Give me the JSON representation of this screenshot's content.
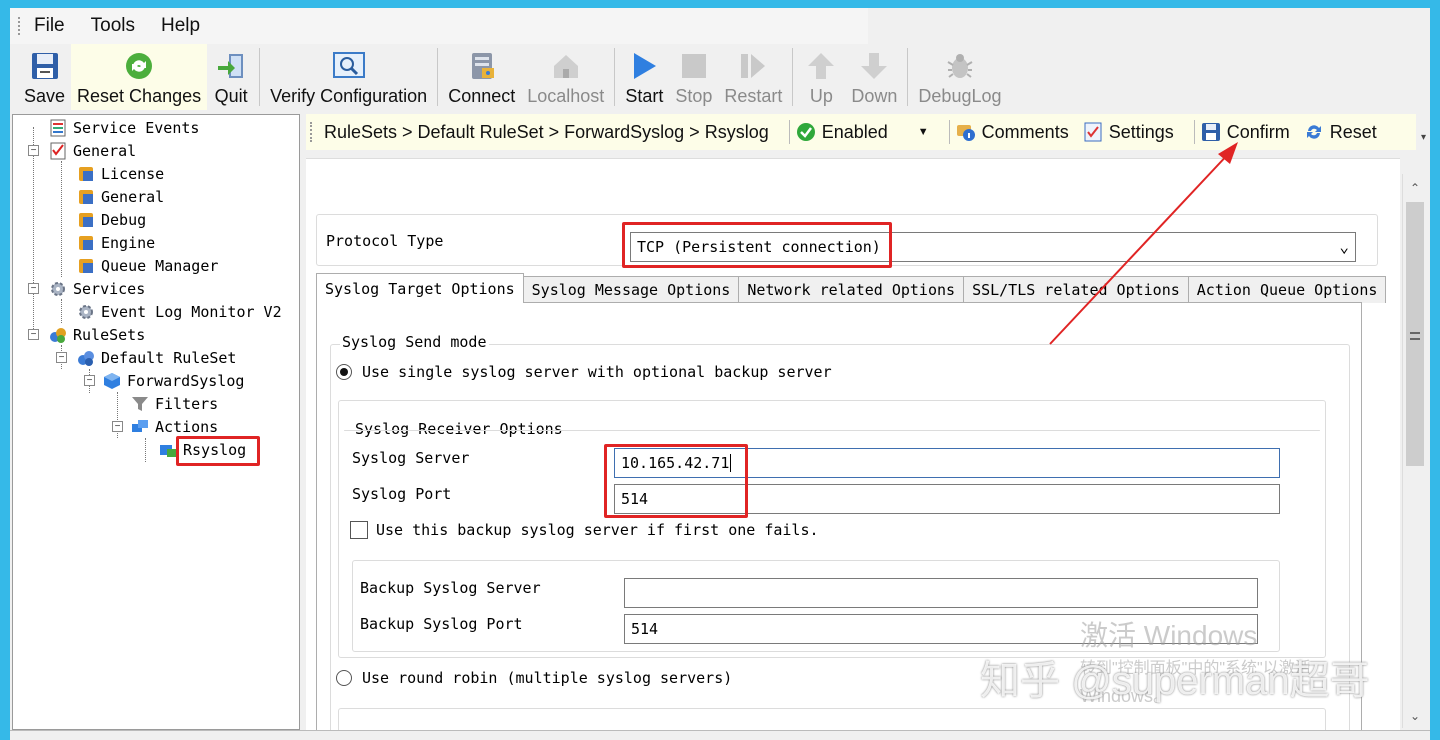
{
  "menu": [
    "File",
    "Tools",
    "Help"
  ],
  "toolbar": {
    "save": "Save",
    "reset_changes": "Reset Changes",
    "quit": "Quit",
    "verify": "Verify Configuration",
    "connect": "Connect",
    "localhost": "Localhost",
    "start": "Start",
    "stop": "Stop",
    "restart": "Restart",
    "up": "Up",
    "down": "Down",
    "debuglog": "DebugLog"
  },
  "tree": {
    "service_events": "Service Events",
    "general": "General",
    "license": "License",
    "general_child": "General",
    "debug": "Debug",
    "engine": "Engine",
    "queue_manager": "Queue Manager",
    "services": "Services",
    "event_log_monitor": "Event Log Monitor V2",
    "rulesets": "RuleSets",
    "default_ruleset": "Default RuleSet",
    "forward_syslog": "ForwardSyslog",
    "filters": "Filters",
    "actions": "Actions",
    "rsyslog": "Rsyslog"
  },
  "breadcrumb": {
    "path": "RuleSets > Default RuleSet > ForwardSyslog > Rsyslog",
    "enabled": "Enabled",
    "comments": "Comments",
    "settings": "Settings",
    "confirm": "Confirm",
    "reset": "Reset"
  },
  "form": {
    "protocol_label": "Protocol Type",
    "protocol_value": "TCP (Persistent connection)",
    "tabs": [
      "Syslog Target Options",
      "Syslog Message Options",
      "Network related Options",
      "SSL/TLS related Options",
      "Action Queue Options"
    ],
    "send_mode_title": "Syslog Send mode",
    "radio_single": "Use single syslog server with optional backup server",
    "receiver_title": "Syslog Receiver Options",
    "server_label": "Syslog Server",
    "server_value": "10.165.42.71",
    "port_label": "Syslog Port",
    "port_value": "514",
    "backup_check": "Use this backup syslog server if first one fails.",
    "backup_server_label": "Backup Syslog Server",
    "backup_server_value": "",
    "backup_port_label": "Backup Syslog Port",
    "backup_port_value": "514",
    "radio_round_robin": "Use round robin (multiple syslog servers)"
  },
  "watermark": {
    "activate": "激活 Windows",
    "activate_sub": "转到\"控制面板\"中的\"系统\"以激活",
    "windows": "Windows。",
    "zhihu": "知乎 @superman超哥"
  },
  "colors": {
    "annotation_red": "#e02424",
    "breadcrumb_bg": "#fdfde8",
    "desktop": "#35b9e8"
  }
}
